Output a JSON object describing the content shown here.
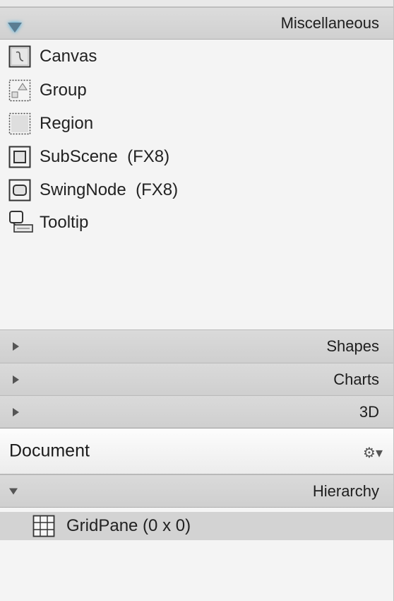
{
  "library": {
    "expanded_section": "Miscellaneous",
    "items": [
      {
        "label": "Canvas",
        "icon": "canvas-icon"
      },
      {
        "label": "Group",
        "icon": "group-icon"
      },
      {
        "label": "Region",
        "icon": "region-icon"
      },
      {
        "label": "SubScene  (FX8)",
        "icon": "subscene-icon"
      },
      {
        "label": "SwingNode  (FX8)",
        "icon": "swingnode-icon"
      },
      {
        "label": "Tooltip",
        "icon": "tooltip-icon"
      }
    ],
    "collapsed_sections": [
      "Shapes",
      "Charts",
      "3D"
    ]
  },
  "document": {
    "title": "Document",
    "menu_icon": "gear-icon",
    "hierarchy_label": "Hierarchy",
    "tree": [
      {
        "label": "GridPane (0 x 0)",
        "icon": "gridpane-icon"
      }
    ]
  }
}
